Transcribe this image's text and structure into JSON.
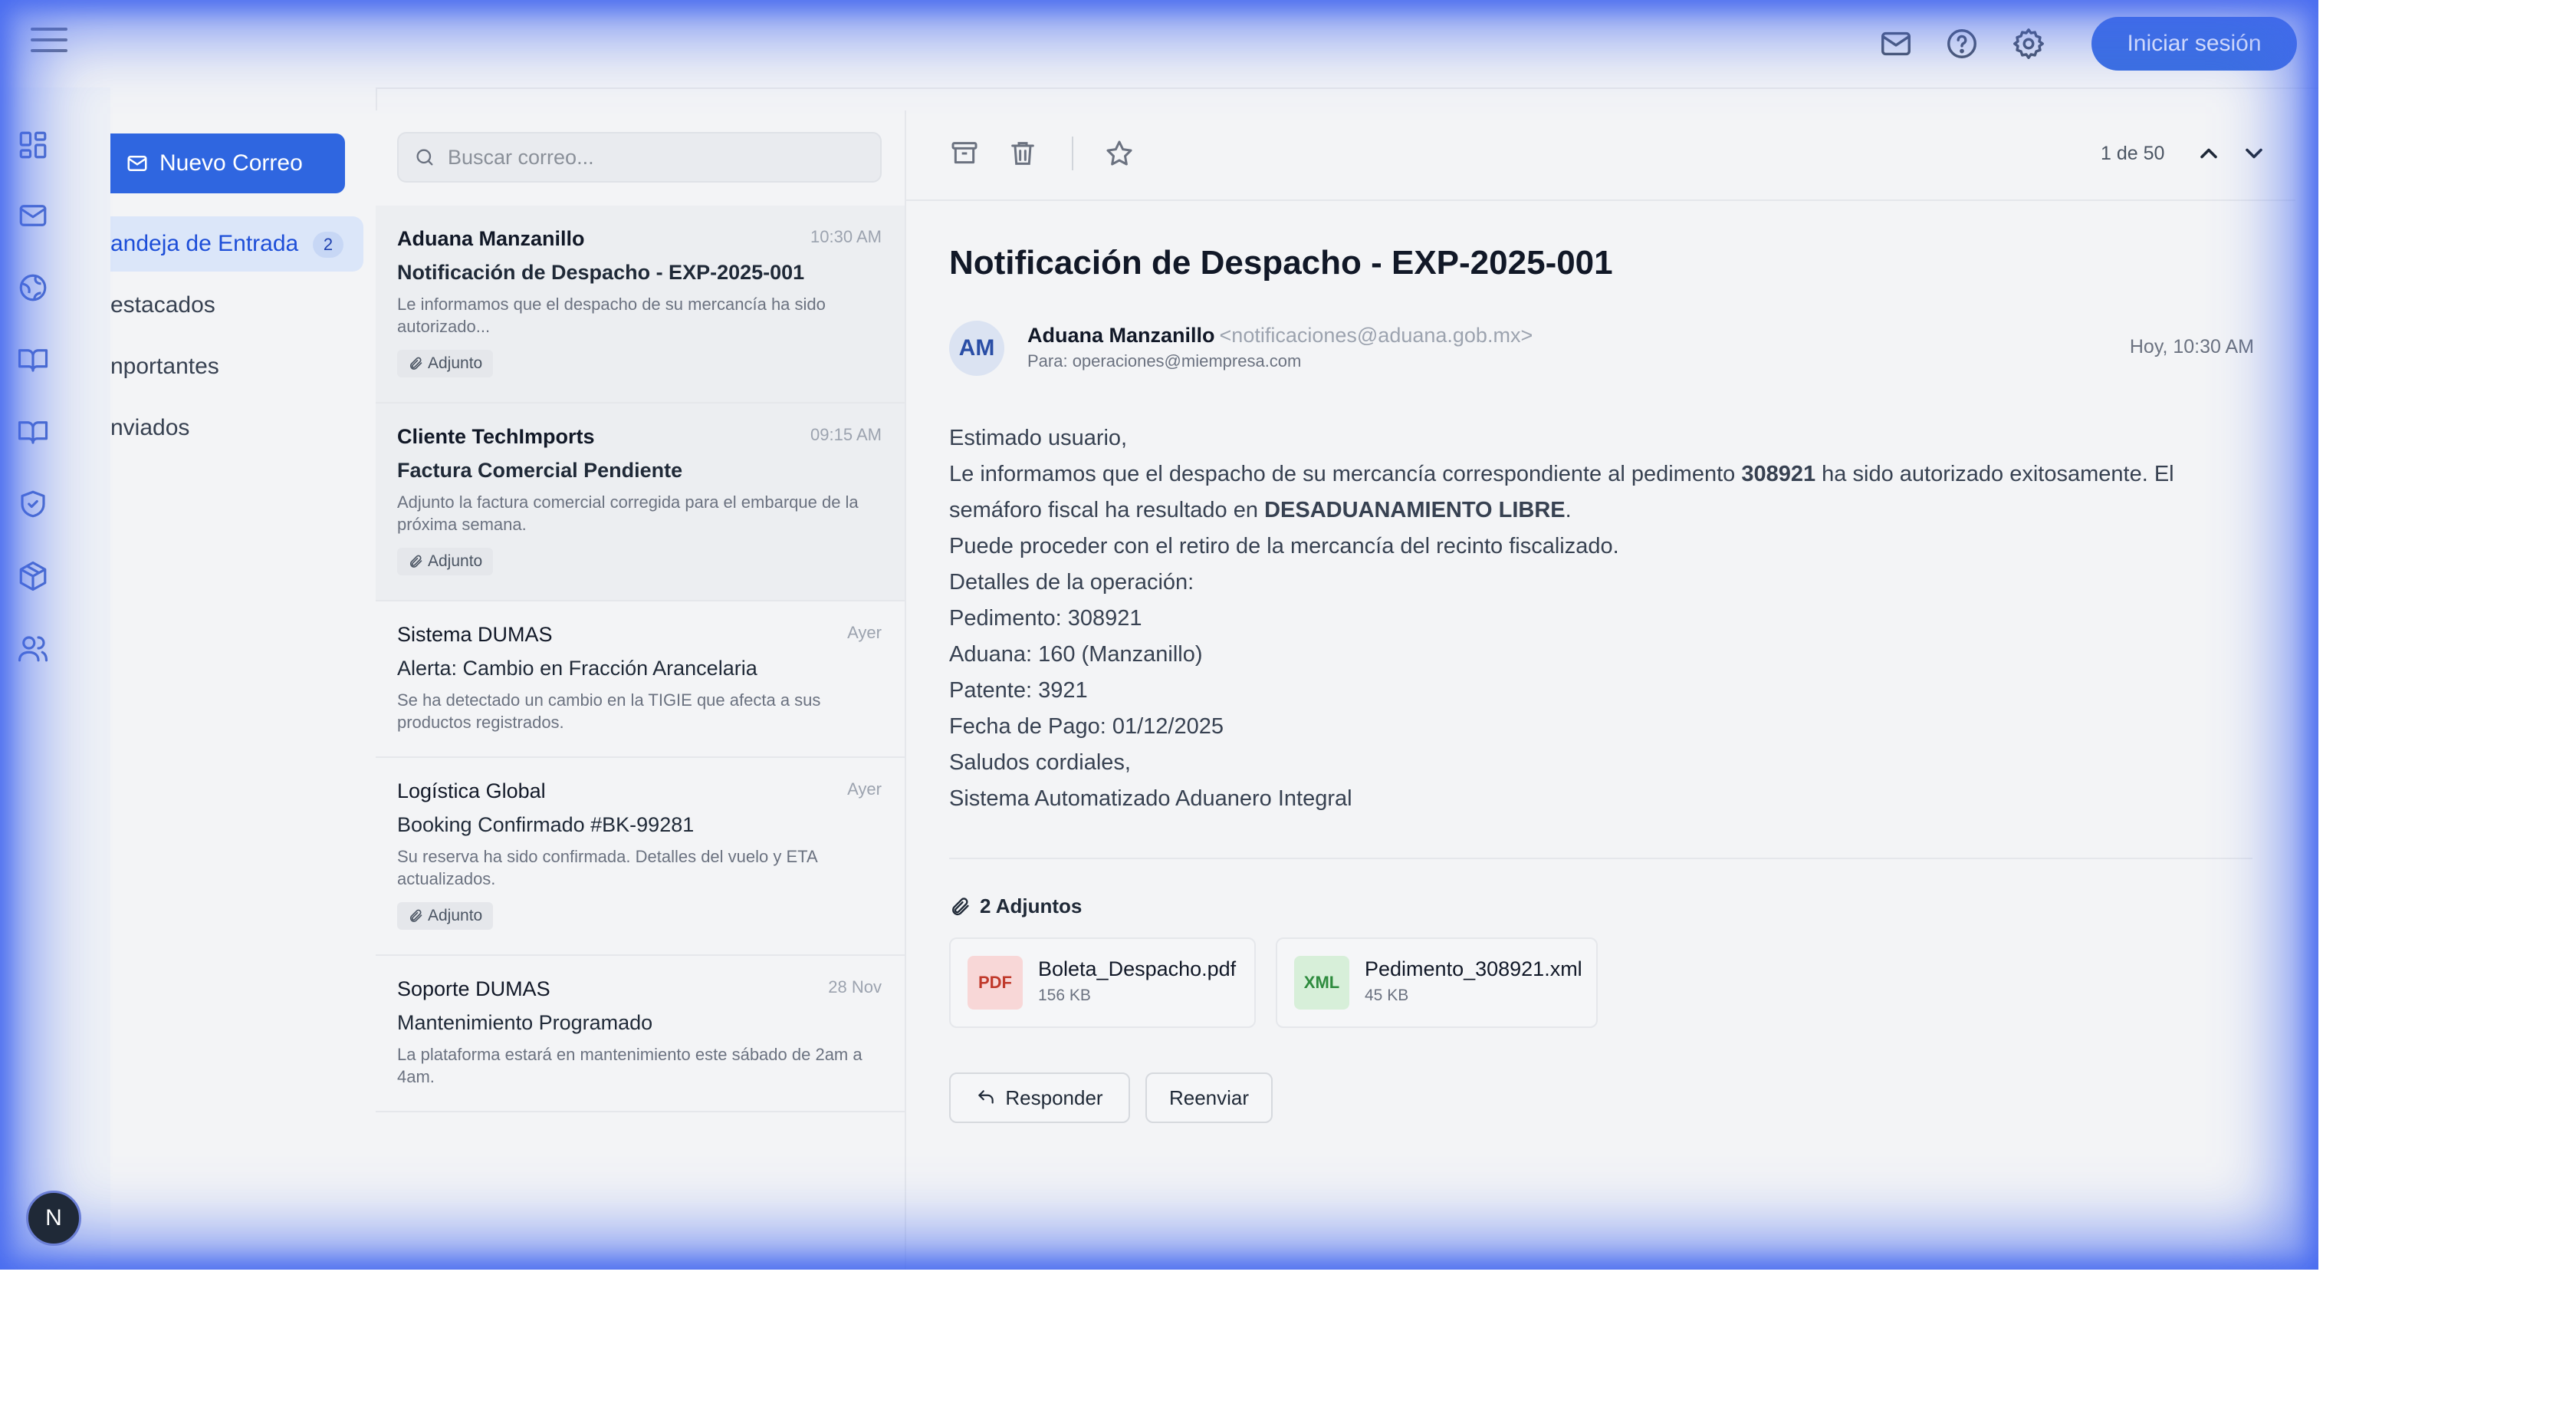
{
  "header": {
    "login_label": "Iniciar sesión",
    "icons": [
      "menu-icon",
      "mail-icon",
      "help-icon",
      "gear-icon"
    ]
  },
  "rail": {
    "icons": [
      "dashboard-icon",
      "mail-icon",
      "globe-icon",
      "book-open-icon",
      "book-icon",
      "shield-check-icon",
      "package-icon",
      "users-icon"
    ],
    "user_initial": "N"
  },
  "folders": {
    "new_mail_label": "Nuevo Correo",
    "items": [
      {
        "label": "andeja de Entrada",
        "count": "2"
      },
      {
        "label": "estacados"
      },
      {
        "label": "nportantes"
      },
      {
        "label": "nviados"
      }
    ]
  },
  "search": {
    "placeholder": "Buscar correo..."
  },
  "emails": [
    {
      "sender": "Aduana Manzanillo",
      "time": "10:30 AM",
      "subject": "Notificación de Despacho - EXP-2025-001",
      "preview": "Le informamos que el despacho de su mercancía ha sido autorizado...",
      "attachment": "Adjunto"
    },
    {
      "sender": "Cliente TechImports",
      "time": "09:15 AM",
      "subject": "Factura Comercial Pendiente",
      "preview": "Adjunto la factura comercial corregida para el embarque de la próxima semana.",
      "attachment": "Adjunto"
    },
    {
      "sender": "Sistema DUMAS",
      "time": "Ayer",
      "subject": "Alerta: Cambio en Fracción Arancelaria",
      "preview": "Se ha detectado un cambio en la TIGIE que afecta a sus productos registrados."
    },
    {
      "sender": "Logística Global",
      "time": "Ayer",
      "subject": "Booking Confirmado #BK-99281",
      "preview": "Su reserva ha sido confirmada. Detalles del vuelo y ETA actualizados.",
      "attachment": "Adjunto"
    },
    {
      "sender": "Soporte DUMAS",
      "time": "28 Nov",
      "subject": "Mantenimiento Programado",
      "preview": "La plataforma estará en mantenimiento este sábado de 2am a 4am."
    }
  ],
  "reader": {
    "pager": "1 de 50",
    "title": "Notificación de Despacho - EXP-2025-001",
    "avatar": "AM",
    "from_name": "Aduana Manzanillo",
    "from_email": "<notificaciones@aduana.gob.mx>",
    "to": "Para: operaciones@miempresa.com",
    "date": "Hoy, 10:30 AM",
    "body": {
      "greeting": "Estimado usuario,",
      "line1_a": "Le informamos que el despacho de su mercancía correspondiente al pedimento ",
      "line1_bold": "308921",
      "line1_b": " ha sido autorizado exitosamente. El semáforo fiscal ha resultado en ",
      "line1_bold2": "DESADUANAMIENTO LIBRE",
      "line1_c": ".",
      "line2": "Puede proceder con el retiro de la mercancía del recinto fiscalizado.",
      "line3": "Detalles de la operación:",
      "line4": "Pedimento: 308921",
      "line5": "Aduana: 160 (Manzanillo)",
      "line6": "Patente: 3921",
      "line7": "Fecha de Pago: 01/12/2025",
      "line8": "Saludos cordiales,",
      "line9": "Sistema Automatizado Aduanero Integral"
    },
    "attachments_label": "2 Adjuntos",
    "attachments": [
      {
        "type": "PDF",
        "name": "Boleta_Despacho.pdf",
        "size": "156 KB",
        "color": "#c0392b",
        "bg": "#f8d7d7"
      },
      {
        "type": "XML",
        "name": "Pedimento_308921.xml",
        "size": "45 KB",
        "color": "#2e8b3e",
        "bg": "#d7efd9"
      }
    ],
    "reply_label": "Responder",
    "forward_label": "Reenviar"
  },
  "colors": {
    "accent": "#2f66e0",
    "glow": "#4669f0"
  }
}
